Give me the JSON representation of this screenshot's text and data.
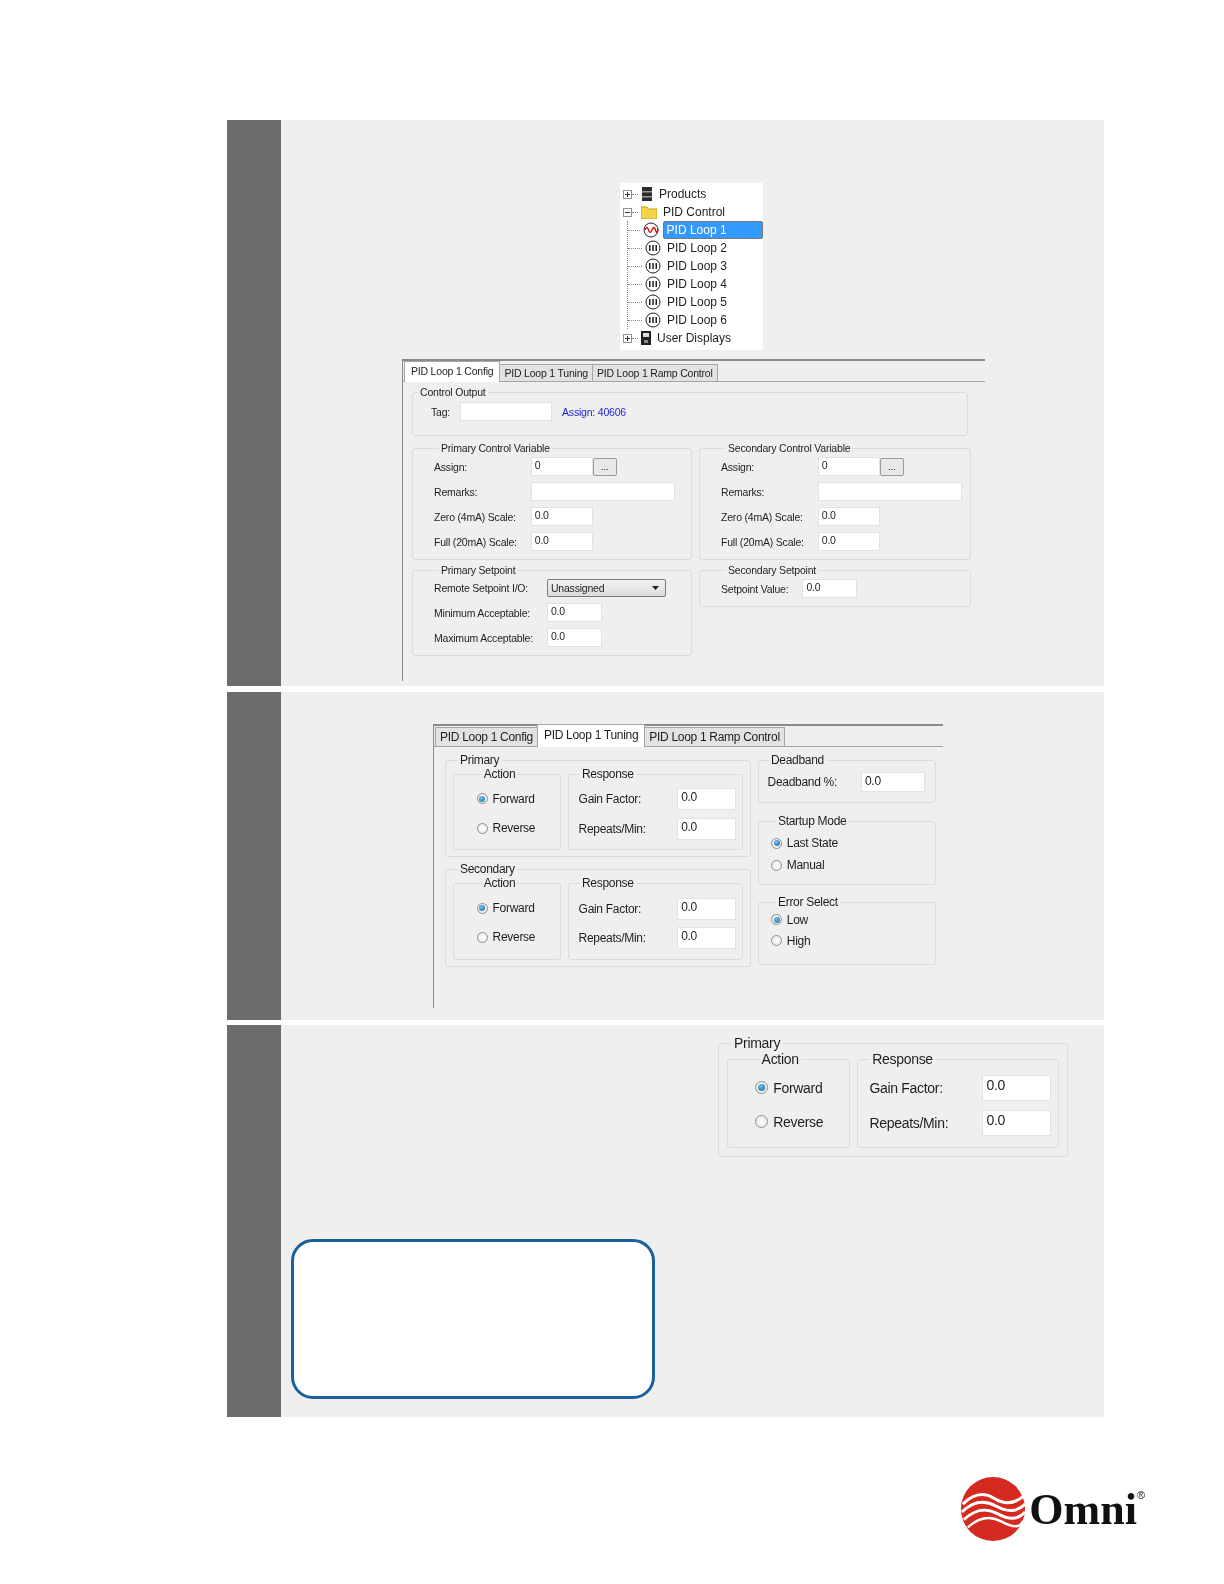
{
  "tree": {
    "items": [
      {
        "label": "Products",
        "kind": "products",
        "expanded": false
      },
      {
        "label": "PID Control",
        "kind": "folder",
        "expanded": true,
        "children": [
          {
            "label": "PID Loop 1",
            "selected": true
          },
          {
            "label": "PID Loop 2",
            "selected": false
          },
          {
            "label": "PID Loop 3",
            "selected": false
          },
          {
            "label": "PID Loop 4",
            "selected": false
          },
          {
            "label": "PID Loop 5",
            "selected": false
          },
          {
            "label": "PID Loop 6",
            "selected": false
          }
        ]
      },
      {
        "label": "User Displays",
        "kind": "displays",
        "expanded": false
      }
    ]
  },
  "config_panel": {
    "tabs": [
      {
        "label": "PID Loop 1 Config",
        "selected": true
      },
      {
        "label": "PID Loop 1 Tuning",
        "selected": false
      },
      {
        "label": "PID Loop 1 Ramp Control",
        "selected": false
      }
    ],
    "control_output": {
      "title": "Control Output",
      "tag_label": "Tag:",
      "assign_link": "Assign: 40606"
    },
    "groups": [
      {
        "title": "Primary Control Variable",
        "fields": [
          {
            "kind": "browse",
            "label": "Assign:",
            "value": "0",
            "button": "..."
          },
          {
            "kind": "wide",
            "label": "Remarks:"
          },
          {
            "kind": "text",
            "label": "Zero (4mA) Scale:",
            "value": "0.0"
          },
          {
            "kind": "text",
            "label": "Full (20mA) Scale:",
            "value": "0.0"
          }
        ]
      },
      {
        "title": "Secondary Control Variable",
        "fields": [
          {
            "kind": "browse",
            "label": "Assign:",
            "value": "0",
            "button": "..."
          },
          {
            "kind": "wide",
            "label": "Remarks:"
          },
          {
            "kind": "text",
            "label": "Zero (4mA) Scale:",
            "value": "0.0"
          },
          {
            "kind": "text",
            "label": "Full (20mA) Scale:",
            "value": "0.0"
          }
        ]
      },
      {
        "title": "Primary Setpoint",
        "fields": [
          {
            "kind": "select",
            "label": "Remote Setpoint I/O:",
            "value": "Unassigned"
          },
          {
            "kind": "text",
            "label": "Minimum Acceptable:",
            "value": "0.0"
          },
          {
            "kind": "text",
            "label": "Maximum Acceptable:",
            "value": "0.0"
          }
        ]
      },
      {
        "title": "Secondary Setpoint",
        "fields": [
          {
            "kind": "text",
            "label": "Setpoint Value:",
            "value": "0.0"
          }
        ]
      }
    ]
  },
  "tuning_panel": {
    "tabs": [
      {
        "label": "PID Loop 1 Config",
        "selected": false
      },
      {
        "label": "PID Loop 1 Tuning",
        "selected": true
      },
      {
        "label": "PID Loop 1 Ramp Control",
        "selected": false
      }
    ],
    "loops": [
      {
        "title": "Primary",
        "action": {
          "title": "Action",
          "options": [
            {
              "label": "Forward",
              "selected": true
            },
            {
              "label": "Reverse",
              "selected": false
            }
          ]
        },
        "response": {
          "title": "Response",
          "fields": [
            {
              "label": "Gain Factor:",
              "value": "0.0"
            },
            {
              "label": "Repeats/Min:",
              "value": "0.0"
            }
          ]
        }
      },
      {
        "title": "Secondary",
        "action": {
          "title": "Action",
          "options": [
            {
              "label": "Forward",
              "selected": true
            },
            {
              "label": "Reverse",
              "selected": false
            }
          ]
        },
        "response": {
          "title": "Response",
          "fields": [
            {
              "label": "Gain Factor:",
              "value": "0.0"
            },
            {
              "label": "Repeats/Min:",
              "value": "0.0"
            }
          ]
        }
      }
    ],
    "deadband": {
      "title": "Deadband",
      "label": "Deadband %:",
      "value": "0.0"
    },
    "startup_mode": {
      "title": "Startup Mode",
      "options": [
        {
          "label": "Last State",
          "selected": true
        },
        {
          "label": "Manual",
          "selected": false
        }
      ]
    },
    "error_select": {
      "title": "Error Select",
      "options": [
        {
          "label": "Low",
          "selected": true
        },
        {
          "label": "High",
          "selected": false
        }
      ]
    }
  },
  "detail_panel": {
    "loop": {
      "title": "Primary",
      "action": {
        "title": "Action",
        "options": [
          {
            "label": "Forward",
            "selected": true
          },
          {
            "label": "Reverse",
            "selected": false
          }
        ]
      },
      "response": {
        "title": "Response",
        "fields": [
          {
            "label": "Gain Factor:",
            "value": "0.0"
          },
          {
            "label": "Repeats/Min:",
            "value": "0.0"
          }
        ]
      }
    }
  },
  "logo": {
    "name": "Omni",
    "registered": "®"
  }
}
